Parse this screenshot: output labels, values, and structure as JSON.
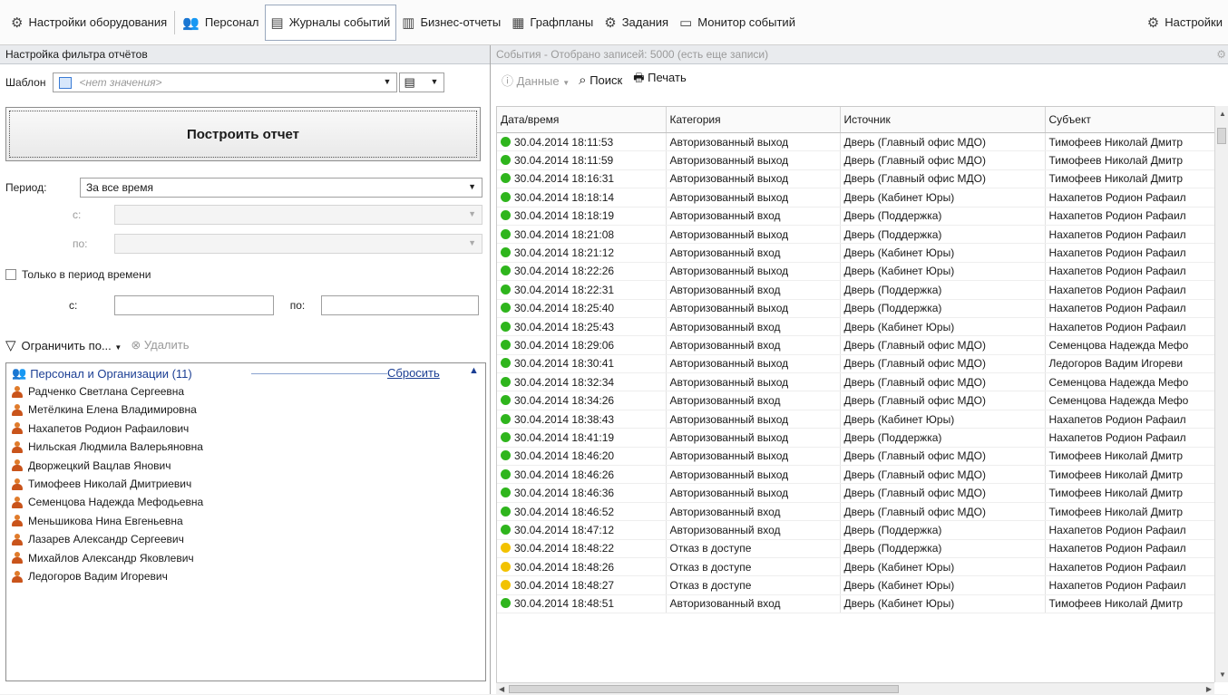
{
  "toolbar": {
    "items": [
      {
        "label": "Настройки оборудования",
        "icon": "⚙"
      },
      {
        "label": "Персонал",
        "icon": "👥"
      },
      {
        "label": "Журналы событий",
        "icon": "▤"
      },
      {
        "label": "Бизнес-отчеты",
        "icon": "▥"
      },
      {
        "label": "Графпланы",
        "icon": "▦"
      },
      {
        "label": "Задания",
        "icon": "⚙"
      },
      {
        "label": "Монитор событий",
        "icon": "▭"
      }
    ],
    "settings": {
      "label": "Настройки",
      "icon": "⚙"
    },
    "active_index": 2
  },
  "filter": {
    "header": "Настройка фильтра отчётов",
    "template_label": "Шаблон",
    "template_value": "<нет значения>",
    "build_button": "Построить отчет",
    "period_label": "Период:",
    "period_value": "За все время",
    "from_label": "с:",
    "to_label": "по:",
    "only_period_label": "Только в период времени",
    "time_from_label": "с:",
    "time_to_label": "по:",
    "restrict_label": "Ограничить по...",
    "delete_label": "Удалить"
  },
  "personnel_group": {
    "title": "Персонал и Организации (11)",
    "reset": "Сбросить",
    "people": [
      "Радченко Светлана Сергеевна",
      "Метёлкина Елена  Владимировна",
      "Нахапетов Родион Рафаилович",
      "Нильская Людмила Валерьяновна",
      "Дворжецкий Вацлав Янович",
      "Тимофеев Николай Дмитриевич",
      "Семенцова Надежда Мефодьевна",
      "Меньшикова Нина Евгеньевна",
      "Лазарев Александр Сергеевич",
      "Михайлов Александр Яковлевич",
      "Ледогоров Вадим Игоревич"
    ]
  },
  "events": {
    "header": "События - Отобрано записей: 5000 (есть еще записи)",
    "data_label": "Данные",
    "search_label": "Поиск",
    "print_label": "Печать",
    "columns": [
      "Дата/время",
      "Категория",
      "Источник",
      "Субъект"
    ],
    "status_colors": {
      "ok": "#2fb51d",
      "denied": "#f2c200"
    },
    "rows": [
      {
        "status": "ok",
        "datetime": "30.04.2014 18:11:53",
        "category": "Авторизованный выход",
        "source": "Дверь (Главный офис МДО)",
        "subject": "Тимофеев Николай Дмитр"
      },
      {
        "status": "ok",
        "datetime": "30.04.2014 18:11:59",
        "category": "Авторизованный выход",
        "source": "Дверь (Главный офис МДО)",
        "subject": "Тимофеев Николай Дмитр"
      },
      {
        "status": "ok",
        "datetime": "30.04.2014 18:16:31",
        "category": "Авторизованный выход",
        "source": "Дверь (Главный офис МДО)",
        "subject": "Тимофеев Николай Дмитр"
      },
      {
        "status": "ok",
        "datetime": "30.04.2014 18:18:14",
        "category": "Авторизованный выход",
        "source": "Дверь (Кабинет Юры)",
        "subject": "Нахапетов Родион Рафаил"
      },
      {
        "status": "ok",
        "datetime": "30.04.2014 18:18:19",
        "category": "Авторизованный вход",
        "source": "Дверь (Поддержка)",
        "subject": "Нахапетов Родион Рафаил"
      },
      {
        "status": "ok",
        "datetime": "30.04.2014 18:21:08",
        "category": "Авторизованный выход",
        "source": "Дверь (Поддержка)",
        "subject": "Нахапетов Родион Рафаил"
      },
      {
        "status": "ok",
        "datetime": "30.04.2014 18:21:12",
        "category": "Авторизованный вход",
        "source": "Дверь (Кабинет Юры)",
        "subject": "Нахапетов Родион Рафаил"
      },
      {
        "status": "ok",
        "datetime": "30.04.2014 18:22:26",
        "category": "Авторизованный выход",
        "source": "Дверь (Кабинет Юры)",
        "subject": "Нахапетов Родион Рафаил"
      },
      {
        "status": "ok",
        "datetime": "30.04.2014 18:22:31",
        "category": "Авторизованный вход",
        "source": "Дверь (Поддержка)",
        "subject": "Нахапетов Родион Рафаил"
      },
      {
        "status": "ok",
        "datetime": "30.04.2014 18:25:40",
        "category": "Авторизованный выход",
        "source": "Дверь (Поддержка)",
        "subject": "Нахапетов Родион Рафаил"
      },
      {
        "status": "ok",
        "datetime": "30.04.2014 18:25:43",
        "category": "Авторизованный вход",
        "source": "Дверь (Кабинет Юры)",
        "subject": "Нахапетов Родион Рафаил"
      },
      {
        "status": "ok",
        "datetime": "30.04.2014 18:29:06",
        "category": "Авторизованный вход",
        "source": "Дверь (Главный офис МДО)",
        "subject": "Семенцова Надежда Мефо"
      },
      {
        "status": "ok",
        "datetime": "30.04.2014 18:30:41",
        "category": "Авторизованный выход",
        "source": "Дверь (Главный офис МДО)",
        "subject": "Ледогоров Вадим Игореви"
      },
      {
        "status": "ok",
        "datetime": "30.04.2014 18:32:34",
        "category": "Авторизованный выход",
        "source": "Дверь (Главный офис МДО)",
        "subject": "Семенцова Надежда Мефо"
      },
      {
        "status": "ok",
        "datetime": "30.04.2014 18:34:26",
        "category": "Авторизованный вход",
        "source": "Дверь (Главный офис МДО)",
        "subject": "Семенцова Надежда Мефо"
      },
      {
        "status": "ok",
        "datetime": "30.04.2014 18:38:43",
        "category": "Авторизованный выход",
        "source": "Дверь (Кабинет Юры)",
        "subject": "Нахапетов Родион Рафаил"
      },
      {
        "status": "ok",
        "datetime": "30.04.2014 18:41:19",
        "category": "Авторизованный выход",
        "source": "Дверь (Поддержка)",
        "subject": "Нахапетов Родион Рафаил"
      },
      {
        "status": "ok",
        "datetime": "30.04.2014 18:46:20",
        "category": "Авторизованный выход",
        "source": "Дверь (Главный офис МДО)",
        "subject": "Тимофеев Николай Дмитр"
      },
      {
        "status": "ok",
        "datetime": "30.04.2014 18:46:26",
        "category": "Авторизованный выход",
        "source": "Дверь (Главный офис МДО)",
        "subject": "Тимофеев Николай Дмитр"
      },
      {
        "status": "ok",
        "datetime": "30.04.2014 18:46:36",
        "category": "Авторизованный выход",
        "source": "Дверь (Главный офис МДО)",
        "subject": "Тимофеев Николай Дмитр"
      },
      {
        "status": "ok",
        "datetime": "30.04.2014 18:46:52",
        "category": "Авторизованный вход",
        "source": "Дверь (Главный офис МДО)",
        "subject": "Тимофеев Николай Дмитр"
      },
      {
        "status": "ok",
        "datetime": "30.04.2014 18:47:12",
        "category": "Авторизованный вход",
        "source": "Дверь (Поддержка)",
        "subject": "Нахапетов Родион Рафаил"
      },
      {
        "status": "denied",
        "datetime": "30.04.2014 18:48:22",
        "category": "Отказ в доступе",
        "source": "Дверь (Поддержка)",
        "subject": "Нахапетов Родион Рафаил"
      },
      {
        "status": "denied",
        "datetime": "30.04.2014 18:48:26",
        "category": "Отказ в доступе",
        "source": "Дверь (Кабинет Юры)",
        "subject": "Нахапетов Родион Рафаил"
      },
      {
        "status": "denied",
        "datetime": "30.04.2014 18:48:27",
        "category": "Отказ в доступе",
        "source": "Дверь (Кабинет Юры)",
        "subject": "Нахапетов Родион Рафаил"
      },
      {
        "status": "ok",
        "datetime": "30.04.2014 18:48:51",
        "category": "Авторизованный вход",
        "source": "Дверь (Кабинет Юры)",
        "subject": "Тимофеев Николай Дмитр"
      }
    ]
  }
}
